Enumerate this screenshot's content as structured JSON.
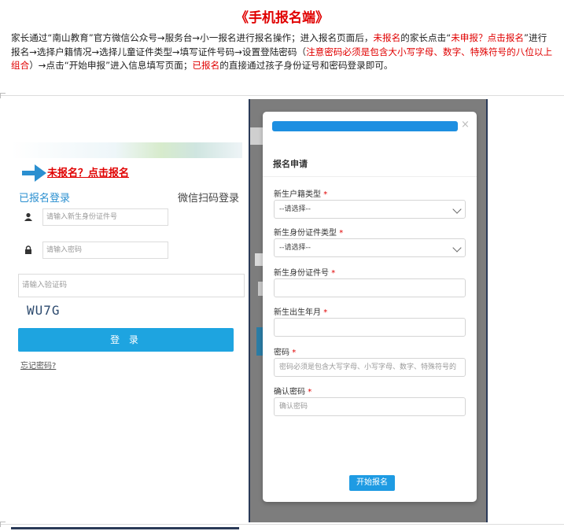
{
  "document": {
    "title": "《手机报名端》",
    "intro": {
      "p1": "家长通过“南山教育”官方微信公众号→服务台→小一报名进行报名操作；进入报名页面后，",
      "p2": "未报名",
      "p3": "的家长点击“",
      "p4": "未申报？点击报名",
      "p5": "”进行报名→选择户籍情况→选择儿童证件类型→填写证件号码→设置登陆密码（",
      "p6": "注意密码必须是包含大小写字母、数字、特殊符号的八位以上组合",
      "p7": "）→点击“开始申报”进入信息填写页面；",
      "p8": "已报名",
      "p9": "的直接通过孩子身份证号和密码登录即可。"
    },
    "accent_color": "#e00000"
  },
  "login": {
    "unregistered_link": "未报名？点击报名",
    "tab_registered": "已报名登录",
    "tab_wechat": "微信扫码登录",
    "id_placeholder": "请输入新生身份证件号",
    "password_placeholder": "请输入密码",
    "captcha_placeholder": "请输入验证码",
    "captcha_text": "WU7G",
    "login_button": "登 录",
    "forgot_password": "忘记密码?",
    "accent_color": "#1ea4e0"
  },
  "modal": {
    "title": "报名申请",
    "close_symbol": "×",
    "fields": {
      "residence_label": "新生户籍类型",
      "residence_value": "--请选择--",
      "id_type_label": "新生身份证件类型",
      "id_type_value": "--请选择--",
      "id_number_label": "新生身份证件号",
      "birth_label": "新生出生年月",
      "password_label": "密码",
      "password_placeholder": "密码必须是包含大写字母、小写字母、数字、特殊符号的",
      "confirm_label": "确认密码",
      "confirm_placeholder": "确认密码",
      "required_mark": "*"
    },
    "submit_button": "开始报名",
    "header_color": "#1e8fe1"
  }
}
